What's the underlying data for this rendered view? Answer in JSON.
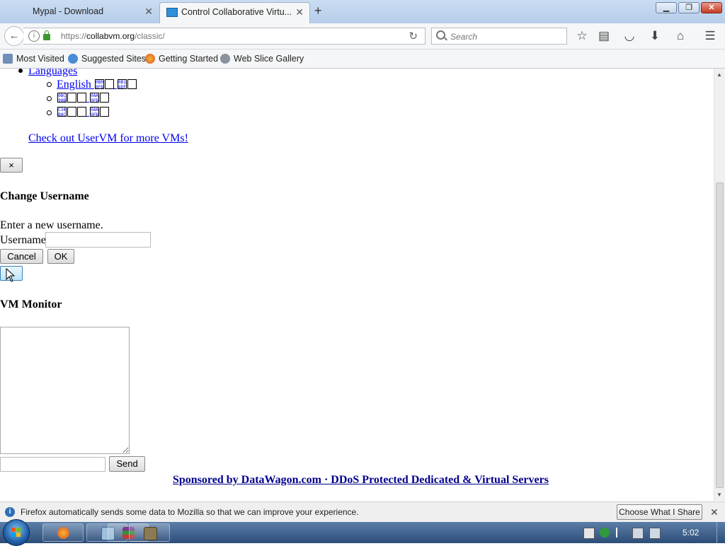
{
  "browser": {
    "tabs": [
      {
        "title": "Mypal - Download",
        "active": false
      },
      {
        "title": "Control Collaborative Virtu...",
        "active": true
      }
    ],
    "new_tab_label": "+",
    "window_buttons": {
      "min": "▁",
      "max": "❐",
      "close": "✕"
    },
    "url": {
      "scheme": "https://",
      "host": "collabvm.org",
      "path": "/classic/"
    },
    "search_placeholder": "Search",
    "bookmarks": [
      {
        "label": "Most Visited",
        "icon": "bookmark-folder-icon"
      },
      {
        "label": "Suggested Sites",
        "icon": "ie-icon"
      },
      {
        "label": "Getting Started",
        "icon": "firefox-icon"
      },
      {
        "label": "Web Slice Gallery",
        "icon": "globe-icon"
      }
    ]
  },
  "page": {
    "languages_label": "Languages",
    "languages": [
      {
        "label": "English",
        "glyphs": [
          "0B0 8FB",
          "0B1 8DF"
        ]
      },
      {
        "label": "",
        "glyphs": [
          "0BC 98B 0BE",
          "0AA 9FB"
        ]
      },
      {
        "label": "",
        "glyphs": [
          "C34 B8C 0BE",
          "0AA 9FB"
        ]
      }
    ],
    "uservm_link": "Check out UserVM for more VMs!",
    "dismiss_label": "×",
    "change_username": {
      "title": "Change Username",
      "instruction": "Enter a new username.",
      "field_label": "Username",
      "value": "",
      "cancel": "Cancel",
      "ok": "OK"
    },
    "vm_monitor": {
      "title": "VM Monitor",
      "log": "",
      "send": "Send",
      "input_value": ""
    },
    "sponsor_text": "Sponsored by DataWagon.com · DDoS Protected Dedicated & Virtual Servers"
  },
  "notification": {
    "message": "Firefox automatically sends some data to Mozilla so that we can improve your experience.",
    "button": "Choose What I Share",
    "close": "✕"
  },
  "taskbar": {
    "apps": [
      "firefox-icon",
      "remote-desktop-icon",
      "winrar-icon",
      "setup-icon"
    ],
    "clock": "5:02"
  }
}
